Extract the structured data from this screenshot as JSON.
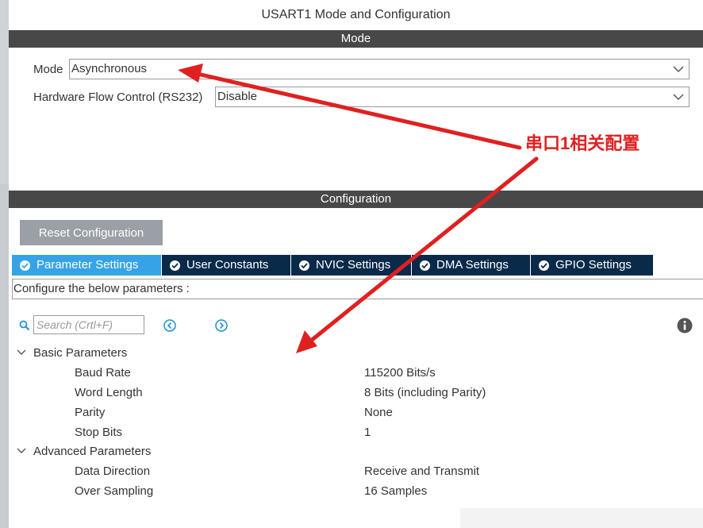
{
  "window_title": "USART1 Mode and Configuration",
  "mode_section": {
    "header": "Mode",
    "mode_label": "Mode",
    "mode_value": "Asynchronous",
    "flow_label": "Hardware Flow Control (RS232)",
    "flow_value": "Disable"
  },
  "config_section": {
    "header": "Configuration",
    "reset_button": "Reset Configuration",
    "tabs": [
      {
        "label": "Parameter Settings",
        "active": true
      },
      {
        "label": "User Constants",
        "active": false
      },
      {
        "label": "NVIC Settings",
        "active": false
      },
      {
        "label": "DMA Settings",
        "active": false
      },
      {
        "label": "GPIO Settings",
        "active": false
      }
    ],
    "configure_text": "Configure the below parameters :",
    "search_placeholder": "Search (Crtl+F)"
  },
  "parameters": {
    "basic": {
      "title": "Basic Parameters",
      "items": [
        {
          "name": "Baud Rate",
          "value": "115200 Bits/s"
        },
        {
          "name": "Word Length",
          "value": "8 Bits (including Parity)"
        },
        {
          "name": "Parity",
          "value": "None"
        },
        {
          "name": "Stop Bits",
          "value": "1"
        }
      ]
    },
    "advanced": {
      "title": "Advanced Parameters",
      "items": [
        {
          "name": "Data Direction",
          "value": "Receive and Transmit"
        },
        {
          "name": "Over Sampling",
          "value": "16 Samples"
        }
      ]
    }
  },
  "annotation": {
    "text": "串口1相关配置",
    "color": "#e02020"
  },
  "colors": {
    "header_bar": "#484848",
    "tab_active": "#35a3e6",
    "tab_inactive": "#0a2a4a",
    "reset_button": "#9aa0a6"
  }
}
